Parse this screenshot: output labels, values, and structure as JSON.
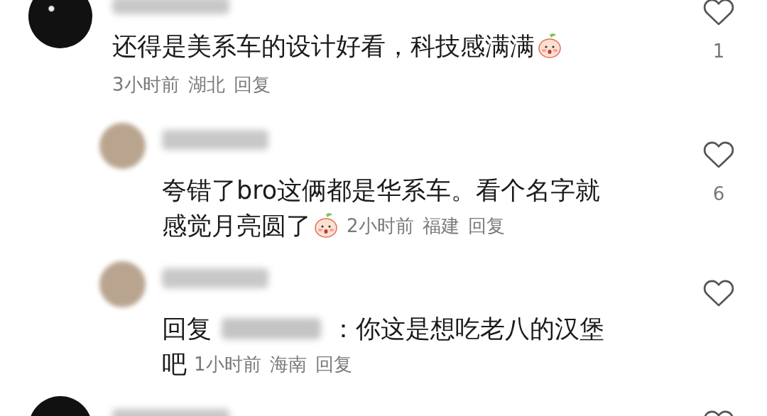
{
  "comments": [
    {
      "kind": "comment",
      "lines": [
        "还得是美系车的设计好看，科技感满满"
      ],
      "emoji": true,
      "time": "3小时前",
      "location": "湖北",
      "reply": "回复",
      "likes": "1"
    },
    {
      "kind": "reply",
      "lines": [
        "夸错了bro这俩都是华系车。看个名字就",
        "感觉月亮圆了"
      ],
      "emoji": true,
      "time": "2小时前",
      "location": "福建",
      "reply": "回复",
      "likes": "6"
    },
    {
      "kind": "reply",
      "reply_prefix": "回复",
      "lines": [
        "：你这是想吃老八的汉堡",
        "吧"
      ],
      "time": "1小时前",
      "location": "海南",
      "reply": "回复"
    },
    {
      "kind": "comment"
    }
  ]
}
